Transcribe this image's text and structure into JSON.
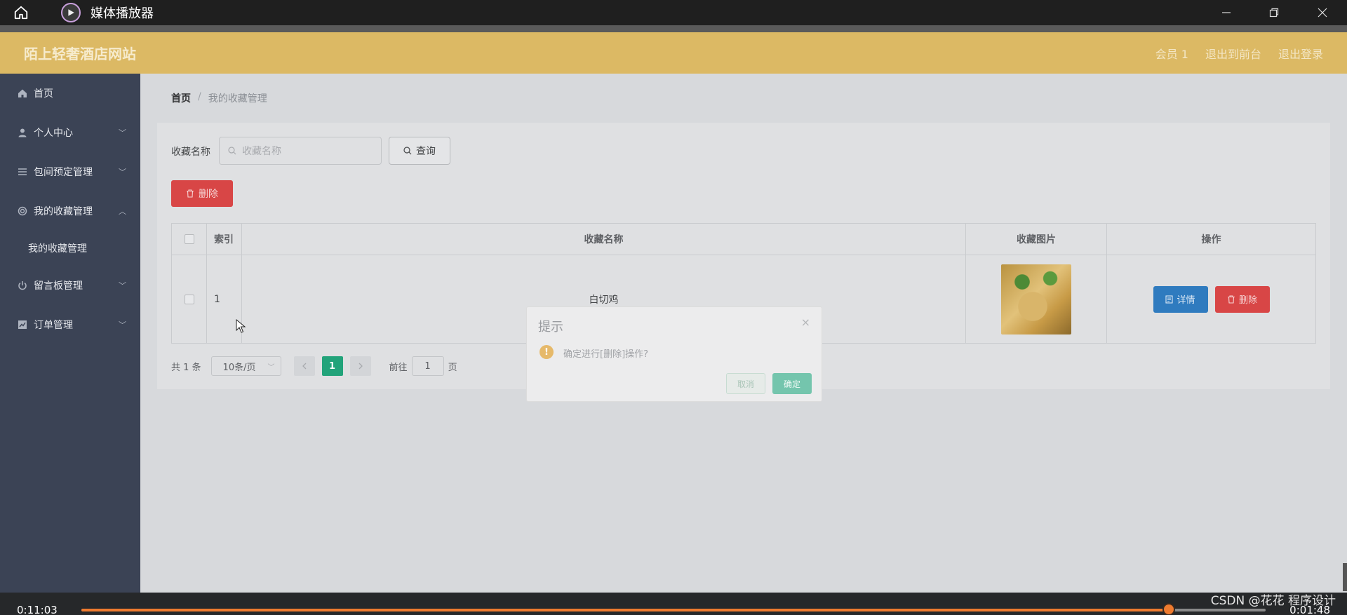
{
  "player": {
    "app_name": "媒体播放器",
    "current_time": "0:11:03",
    "remaining_time": "0:01:48",
    "progress": 0.918,
    "watermark": "CSDN @花花 程序设计"
  },
  "header": {
    "site_title": "陌上轻奢酒店网站",
    "links": [
      "会员 1",
      "退出到前台",
      "退出登录"
    ]
  },
  "sidebar": {
    "items": [
      {
        "label": "首页",
        "icon": "home-icon"
      },
      {
        "label": "个人中心",
        "icon": "user-icon"
      },
      {
        "label": "包间预定管理",
        "icon": "list-icon"
      },
      {
        "label": "我的收藏管理",
        "icon": "settings-icon"
      },
      {
        "label": "我的收藏管理",
        "icon": ""
      },
      {
        "label": "留言板管理",
        "icon": "power-icon"
      },
      {
        "label": "订单管理",
        "icon": "chart-icon"
      }
    ]
  },
  "breadcrumb": {
    "home": "首页",
    "separator": "/",
    "current": "我的收藏管理"
  },
  "search": {
    "label": "收藏名称",
    "placeholder": "收藏名称",
    "query_button": "查询"
  },
  "toolbar": {
    "delete_button": "删除"
  },
  "table": {
    "columns": [
      "索引",
      "收藏名称",
      "收藏图片",
      "操作"
    ],
    "rows": [
      {
        "index": "1",
        "name": "白切鸡",
        "image": "白切鸡",
        "actions": [
          "详情",
          "删除"
        ]
      }
    ]
  },
  "pagination": {
    "total": "共 1 条",
    "page_size": "10条/页",
    "current_page": "1",
    "goto_label": "前往",
    "goto_value": "1",
    "page_suffix": "页"
  },
  "dialog": {
    "title": "提示",
    "message": "确定进行[删除]操作?",
    "cancel": "取消",
    "confirm": "确定",
    "close": "×"
  },
  "colors": {
    "header": "#dcb964",
    "sidebar": "#3b4355",
    "primary": "#22a37a",
    "danger": "#d84646",
    "info": "#2f7bbf",
    "player_accent": "#ef7b2f"
  }
}
